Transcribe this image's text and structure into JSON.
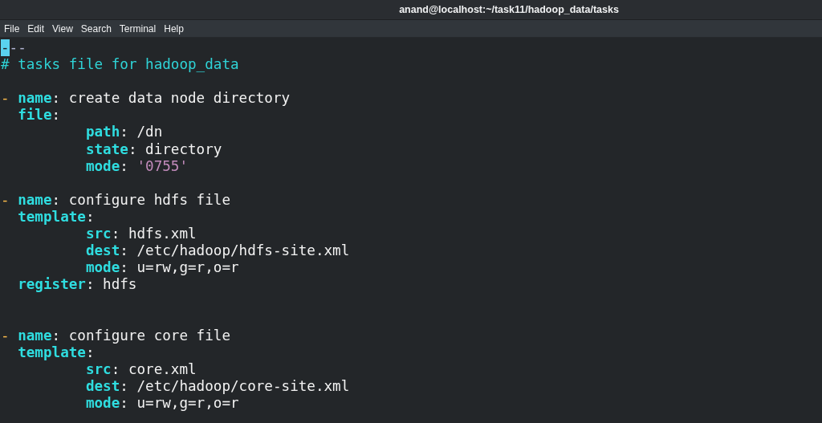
{
  "window": {
    "title": "anand@localhost:~/task11/hadoop_data/tasks"
  },
  "menu": [
    "File",
    "Edit",
    "View",
    "Search",
    "Terminal",
    "Help"
  ],
  "editor": {
    "lines": [
      {
        "kind": "document_start",
        "segments": [
          {
            "text": "-",
            "cursor": true
          },
          {
            "text": "--",
            "cursor": false
          }
        ]
      },
      {
        "kind": "comment",
        "text": "# tasks file for hadoop_data"
      },
      {
        "kind": "blank"
      },
      {
        "kind": "task",
        "marker": "-",
        "entries": [
          {
            "key": "name",
            "sep": ":",
            "value": "create data node directory",
            "quoted": false
          },
          {
            "key": "file",
            "sep": ":",
            "children": [
              {
                "key": "path",
                "sep": ":",
                "value": "/dn",
                "quoted": false
              },
              {
                "key": "state",
                "sep": ":",
                "value": "directory",
                "quoted": false
              },
              {
                "key": "mode",
                "sep": ":",
                "value": "'0755'",
                "quoted": true
              }
            ]
          }
        ]
      },
      {
        "kind": "blank"
      },
      {
        "kind": "task",
        "marker": "-",
        "entries": [
          {
            "key": "name",
            "sep": ":",
            "value": "configure hdfs file",
            "quoted": false
          },
          {
            "key": "template",
            "sep": ":",
            "children": [
              {
                "key": "src",
                "sep": ":",
                "value": "hdfs.xml",
                "quoted": false
              },
              {
                "key": "dest",
                "sep": ":",
                "value": "/etc/hadoop/hdfs-site.xml",
                "quoted": false
              },
              {
                "key": "mode",
                "sep": ":",
                "value": "u=rw,g=r,o=r",
                "quoted": false
              }
            ]
          },
          {
            "key": "register",
            "sep": ":",
            "value": "hdfs",
            "quoted": false
          }
        ]
      },
      {
        "kind": "blank"
      },
      {
        "kind": "blank"
      },
      {
        "kind": "task",
        "marker": "-",
        "entries": [
          {
            "key": "name",
            "sep": ":",
            "value": "configure core file",
            "quoted": false
          },
          {
            "key": "template",
            "sep": ":",
            "children": [
              {
                "key": "src",
                "sep": ":",
                "value": "core.xml",
                "quoted": false
              },
              {
                "key": "dest",
                "sep": ":",
                "value": "/etc/hadoop/core-site.xml",
                "quoted": false
              },
              {
                "key": "mode",
                "sep": ":",
                "value": "u=rw,g=r,o=r",
                "quoted": false
              }
            ]
          }
        ]
      }
    ]
  }
}
